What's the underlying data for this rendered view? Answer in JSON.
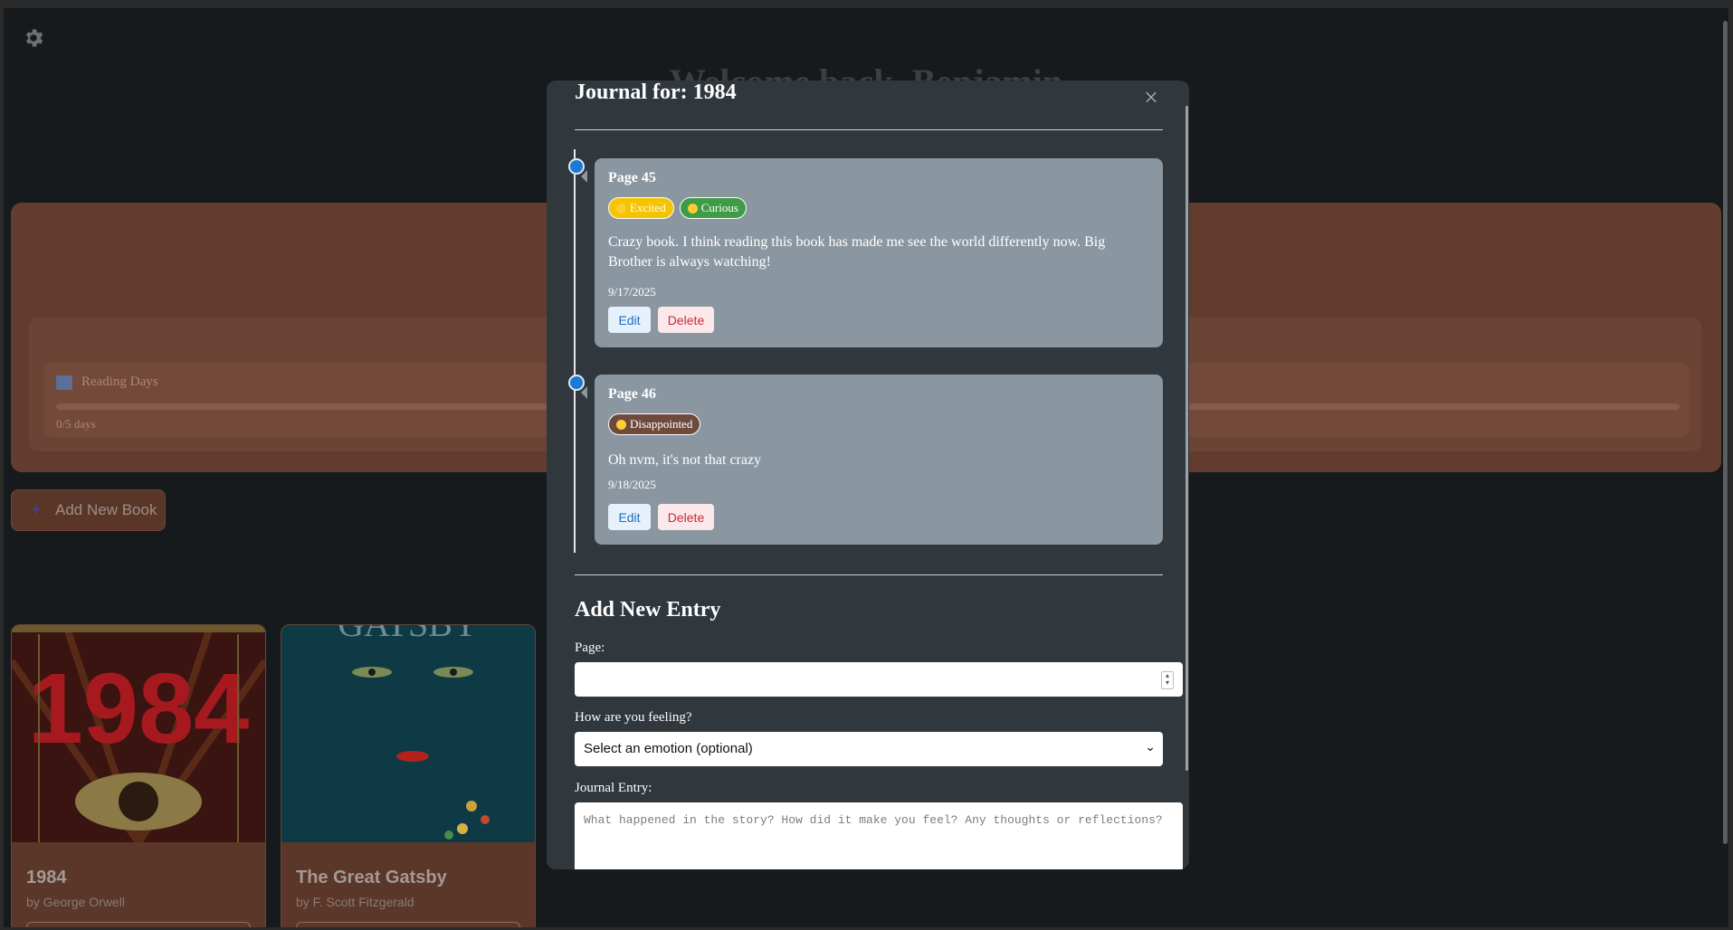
{
  "page": {
    "heading": "Welcome back, Benjamin",
    "goal": {
      "title": "Reading Days",
      "count": "0/5 days"
    },
    "add_book_label": "Add New Book",
    "books": [
      {
        "title": "1984",
        "author": "by George Orwell"
      },
      {
        "title": "The Great Gatsby",
        "author": "by F. Scott Fitzgerald"
      }
    ]
  },
  "modal": {
    "title": "Journal for: 1984",
    "entries": [
      {
        "page": "Page 45",
        "tags": [
          {
            "label": "Excited",
            "color": "#f5c400"
          },
          {
            "label": "Curious",
            "color": "#3f9b45"
          }
        ],
        "text": "Crazy book. I think reading this book has made me see the world differently now. Big Brother is always watching!",
        "date": "9/17/2025",
        "edit_label": "Edit",
        "delete_label": "Delete"
      },
      {
        "page": "Page 46",
        "tags": [
          {
            "label": "Disappointed",
            "color": "#6e4a3c"
          }
        ],
        "text": "Oh nvm, it's not that crazy",
        "date": "9/18/2025",
        "edit_label": "Edit",
        "delete_label": "Delete"
      }
    ],
    "form": {
      "section_title": "Add New Entry",
      "page_label": "Page:",
      "page_value": "",
      "feeling_label": "How are you feeling?",
      "feeling_selected": "Select an emotion (optional)",
      "entry_label": "Journal Entry:",
      "entry_placeholder": "What happened in the story? How did it make you feel? Any thoughts or reflections?"
    }
  },
  "colors": {
    "accent": "#1a7ad6",
    "entry_card": "#8a97a1",
    "modal_bg": "#30373d"
  }
}
